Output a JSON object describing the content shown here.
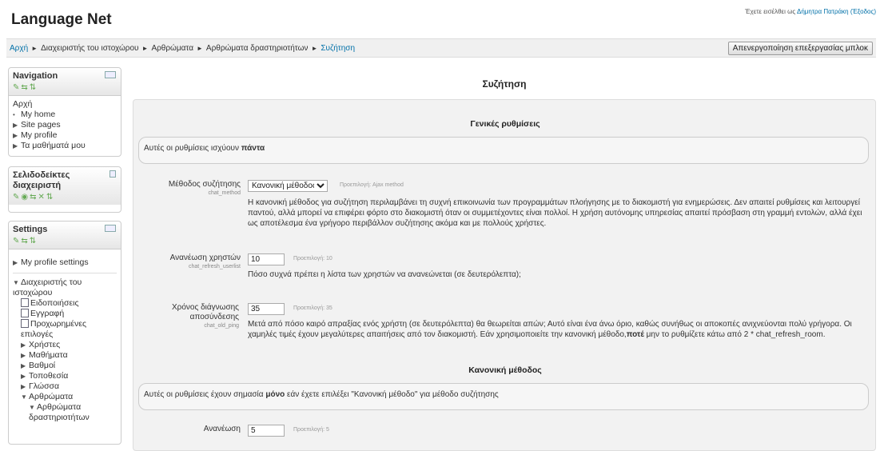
{
  "header": {
    "site_title": "Language Net",
    "login_prefix": "Έχετε εισέλθει ως",
    "login_user": "Δήμητρα Πατράκη",
    "logout": "(Έξοδος)"
  },
  "navbar": {
    "breadcrumb": [
      "Αρχή",
      "Διαχειριστής του ιστοχώρου",
      "Αρθρώματα",
      "Αρθρώματα δραστηριοτήτων",
      "Συζήτηση"
    ],
    "separator": "►",
    "edit_button": "Απενεργοποίηση επεξεργασίας μπλοκ"
  },
  "navigation_block": {
    "title": "Navigation",
    "home": "Αρχή",
    "items": [
      "My home",
      "Site pages",
      "My profile",
      "Τα μαθήματά μου"
    ]
  },
  "bookmarks_block": {
    "title": "Σελιδοδείκτες διαχειριστή"
  },
  "settings_block": {
    "title": "Settings",
    "profile_settings": "My profile settings",
    "admin_root": "Διαχειριστής του ιστοχώρου",
    "notifications": "Ειδοποιήσεις",
    "registration": "Εγγραφή",
    "advanced": "Προχωρημένες επιλογές",
    "users": "Χρήστες",
    "courses": "Μαθήματα",
    "grades": "Βαθμοί",
    "location": "Τοποθεσία",
    "language": "Γλώσσα",
    "plugins": "Αρθρώματα",
    "activity_modules": "Αρθρώματα δραστηριοτήτων"
  },
  "main": {
    "page_title": "Συζήτηση",
    "general_heading": "Γενικές ρυθμίσεις",
    "general_info_text": "Αυτές οι ρυθμίσεις ισχύουν",
    "general_info_bold": "πάντα",
    "method": {
      "label": "Μέθοδος συζήτησης",
      "key": "chat_method",
      "value": "Κανονική μέθοδος",
      "default": "Προεπιλογή: Ajax method",
      "desc": "Η κανονική μέθοδος για συζήτηση περιλαμβάνει τη συχνή επικοινωνία των προγραμμάτων πλοήγησης με το διακομιστή για ενημερώσεις. Δεν απαιτεί ρυθμίσεις και λειτουργεί παντού, αλλά μπορεί να επιφέρει φόρτο στο διακομιστή όταν οι συμμετέχοντες είναι πολλοί. Η χρήση αυτόνομης υπηρεσίας απαιτεί πρόσβαση στη γραμμή εντολών, αλλά έχει ως αποτέλεσμα ένα γρήγορο περιβάλλον συζήτησης ακόμα και με πολλούς χρήστες."
    },
    "refresh_userlist": {
      "label": "Ανανέωση χρηστών",
      "key": "chat_refresh_userlist",
      "value": "10",
      "default": "Προεπιλογή: 10",
      "desc": "Πόσο συχνά πρέπει η λίστα των χρηστών να ανανεώνεται (σε δευτερόλεπτα);"
    },
    "old_ping": {
      "label": "Χρόνος διάγνωσης αποσύνδεσης",
      "key": "chat_old_ping",
      "value": "35",
      "default": "Προεπιλογή: 35",
      "desc_a": "Μετά από πόσο καιρό απραξίας ενός χρήστη (σε δευτερόλεπτα) θα θεωρείται απών; Αυτό είναι ένα άνω όριο, καθώς συνήθως οι αποκοπές ανιχνεύονται πολύ γρήγορα. Οι χαμηλές τιμές έχουν μεγαλύτερες απαιτήσεις από τον διακομιστή. Εάν χρησιμοποιείτε την κανονική μέθοδο,",
      "desc_bold": "ποτέ",
      "desc_b": "μην το ρυθμίζετε κάτω από 2 * chat_refresh_room."
    },
    "normal_heading": "Κανονική μέθοδος",
    "normal_info": "Αυτές οι ρυθμίσεις έχουν σημασία",
    "normal_info_bold": "μόνο",
    "normal_info_end": "εάν έχετε επιλέξει \"Κανονική μέθοδο\" για μέθοδο συζήτησης",
    "refresh_room": {
      "label": "Ανανέωση",
      "value": "5",
      "default": "Προεπιλογή: 5"
    }
  }
}
